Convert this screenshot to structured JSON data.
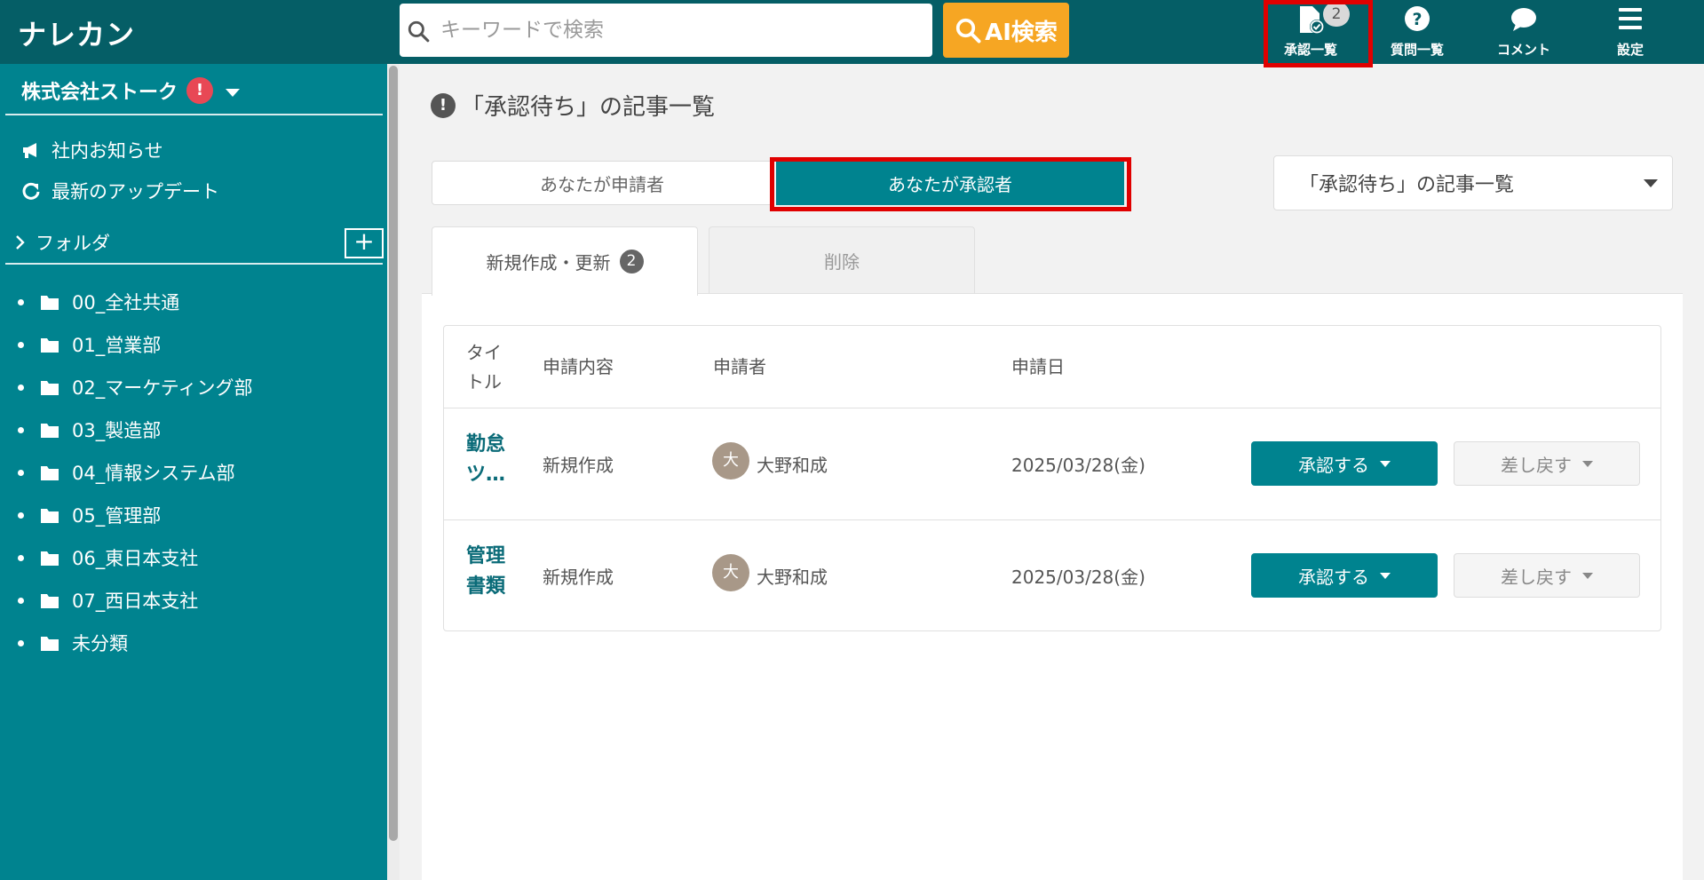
{
  "header": {
    "logo": "ナレカン",
    "search_placeholder": "キーワードで検索",
    "ai_search_label": "AI検索",
    "nav": [
      {
        "label": "承認一覧",
        "badge": "2",
        "icon": "document-check-icon"
      },
      {
        "label": "質問一覧",
        "icon": "question-circle-icon"
      },
      {
        "label": "コメント",
        "icon": "comment-bubble-icon"
      },
      {
        "label": "設定",
        "icon": "hamburger-menu-icon"
      }
    ]
  },
  "sidebar": {
    "company": "株式会社ストーク",
    "alert": "!",
    "links": [
      {
        "label": "社内お知らせ",
        "icon": "megaphone-icon"
      },
      {
        "label": "最新のアップデート",
        "icon": "refresh-icon"
      }
    ],
    "folder_heading": "フォルダ",
    "folder_add": "+",
    "folders": [
      "00_全社共通",
      "01_営業部",
      "02_マーケティング部",
      "03_製造部",
      "04_情報システム部",
      "05_管理部",
      "06_東日本支社",
      "07_西日本支社",
      "未分類"
    ]
  },
  "main": {
    "title": "「承認待ち」の記事一覧",
    "title_icon": "!",
    "segments": {
      "left": "あなたが申請者",
      "right": "あなたが承認者"
    },
    "dropdown": "「承認待ち」の記事一覧",
    "tabs": [
      {
        "label": "新規作成・更新",
        "badge": "2"
      },
      {
        "label": "削除"
      }
    ],
    "table": {
      "headers": [
        "タイトル",
        "申請内容",
        "申請者",
        "申請日"
      ],
      "rows": [
        {
          "title": "勤怠ツ…",
          "type": "新規作成",
          "avatar": "大",
          "applicant": "大野和成",
          "date": "2025/03/28(金)",
          "approve": "承認する",
          "reject": "差し戻す"
        },
        {
          "title": "管理書類",
          "type": "新規作成",
          "avatar": "大",
          "applicant": "大野和成",
          "date": "2025/03/28(金)",
          "approve": "承認する",
          "reject": "差し戻す"
        }
      ]
    }
  },
  "colors": {
    "header": "#055e66",
    "sidebar": "#00838f",
    "accent_orange": "#f6a623",
    "highlight_red": "#e00000",
    "alert_red": "#e84855"
  }
}
